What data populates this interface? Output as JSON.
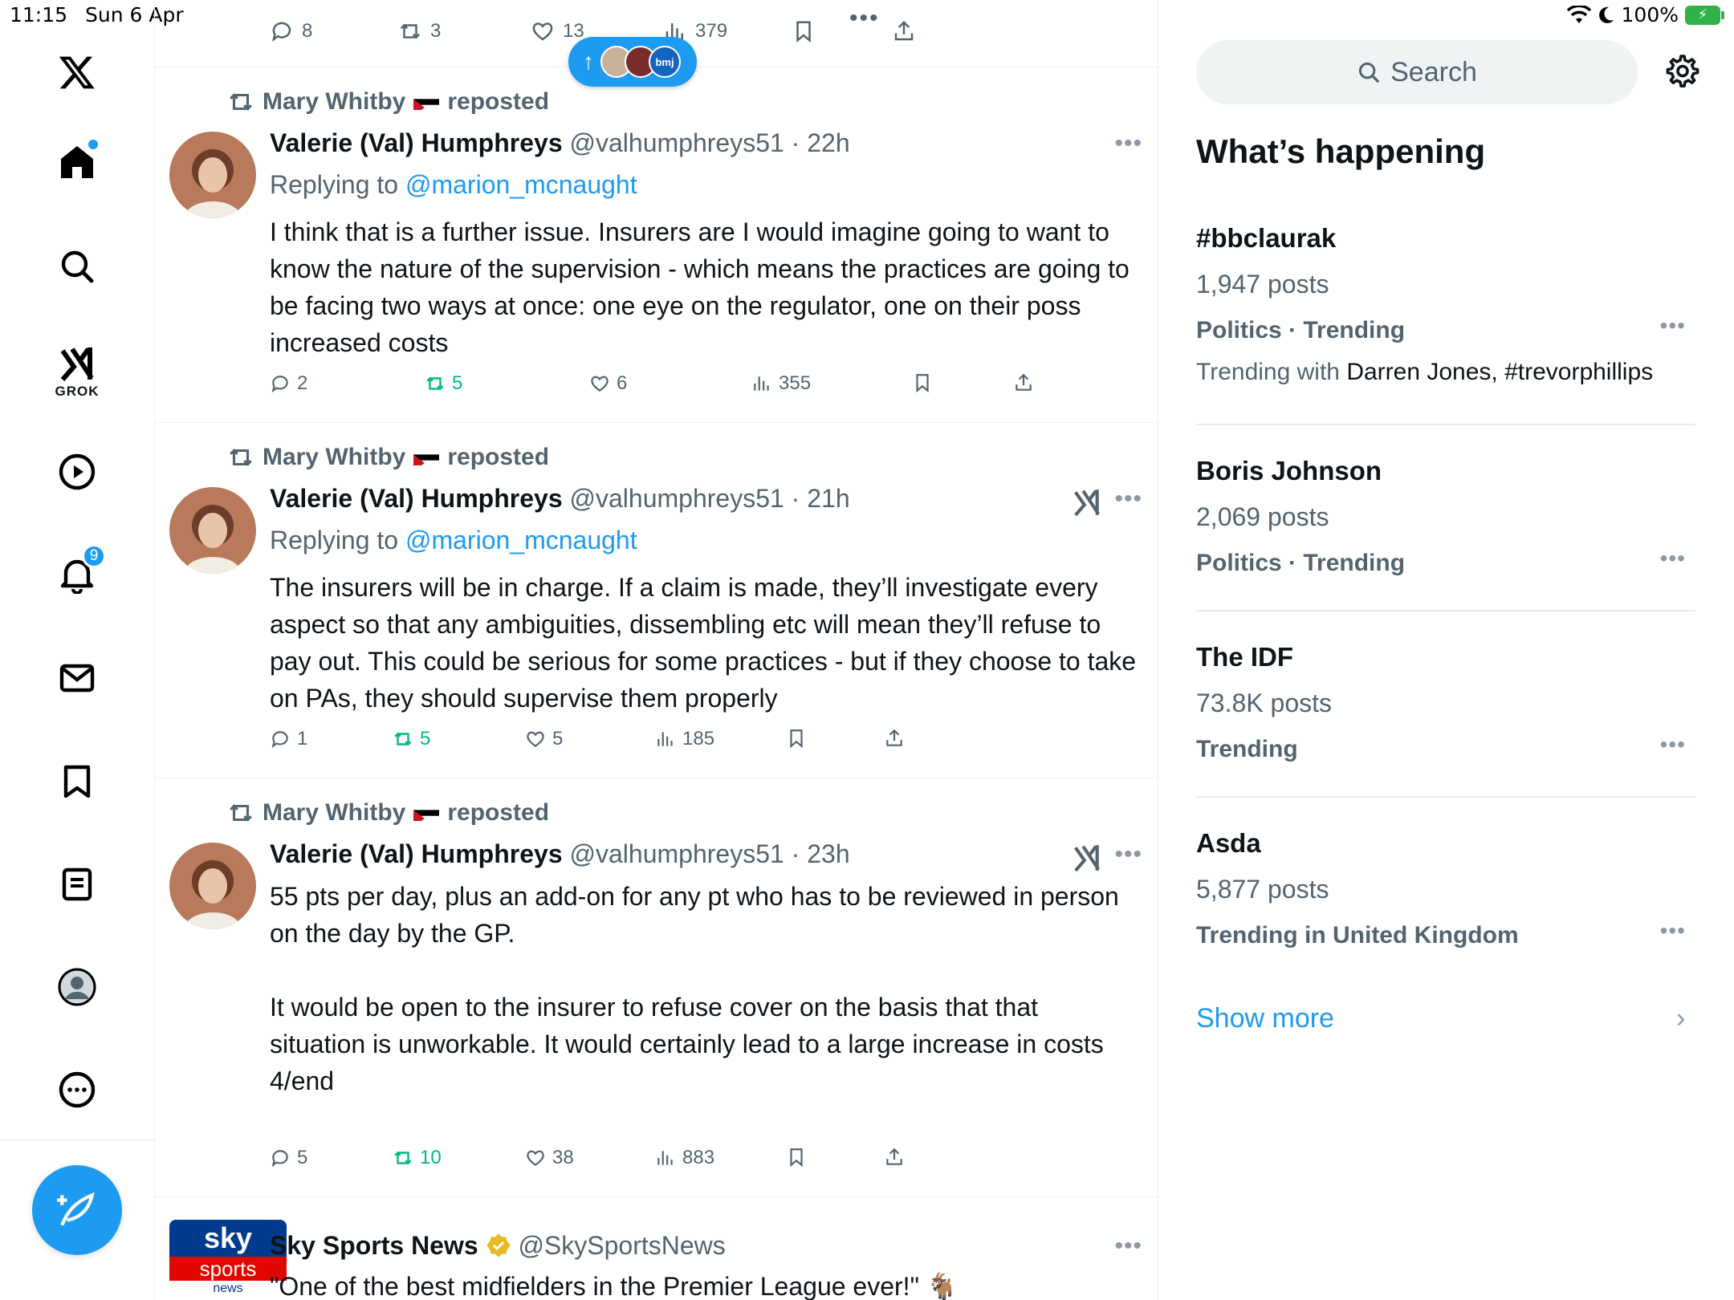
{
  "status_bar": {
    "time": "11:15",
    "date": "Sun 6 Apr",
    "battery": "100%"
  },
  "nav": {
    "grok_label": "GROK",
    "notifications_count": "9"
  },
  "top_actions": {
    "replies": "8",
    "reposts": "3",
    "likes": "13",
    "views": "379"
  },
  "pill": {
    "label": "bmj"
  },
  "tweets": [
    {
      "reposted_by": "Mary Whitby",
      "reposted_label": "reposted",
      "name": "Valerie (Val) Humphreys",
      "handle": "@valhumphreys51 · 22h",
      "replying_prefix": "Replying to ",
      "replying_to": "@marion_mcnaught",
      "text": "I think that is a further issue. Insurers are I would imagine going to want to know the nature of the supervision - which means the practices are going to be facing two ways at once: one eye on the regulator, one on their poss increased costs",
      "replies": "2",
      "reposts": "5",
      "likes": "6",
      "views": "355"
    },
    {
      "reposted_by": "Mary Whitby",
      "reposted_label": "reposted",
      "name": "Valerie (Val) Humphreys",
      "handle": "@valhumphreys51 · 21h",
      "replying_prefix": "Replying to ",
      "replying_to": "@marion_mcnaught",
      "text": "The insurers will be in charge. If a claim is made, they’ll investigate every aspect so that any ambiguities, dissembling etc will mean they’ll refuse to pay out. This could be serious for some practices - but if they choose to take on PAs, they should supervise them properly",
      "replies": "1",
      "reposts": "5",
      "likes": "5",
      "views": "185"
    },
    {
      "reposted_by": "Mary Whitby",
      "reposted_label": "reposted",
      "name": "Valerie (Val) Humphreys",
      "handle": "@valhumphreys51 · 23h",
      "text": "55 pts per day, plus an add-on for any pt who has to be reviewed in person on the day by the GP.\n\nIt would be open to the insurer to refuse cover on the basis that that situation is unworkable. It would certainly lead to a large increase in costs\n4/end",
      "replies": "5",
      "reposts": "10",
      "likes": "38",
      "views": "883"
    },
    {
      "name": "Sky Sports News",
      "handle": "@SkySportsNews",
      "text": "\"One of the best midfielders in the Premier League ever!\" 🐐",
      "avatar_text_1": "sky",
      "avatar_text_2": "sports",
      "avatar_text_3": "news"
    }
  ],
  "sidebar": {
    "search_placeholder": "Search",
    "title": "What’s happening",
    "trends": [
      {
        "name": "#bbclaurak",
        "posts": "1,947 posts",
        "category": "Politics · Trending",
        "with_prefix": "Trending with ",
        "with": "Darren Jones, #trevorphillips"
      },
      {
        "name": "Boris Johnson",
        "posts": "2,069 posts",
        "category": "Politics · Trending"
      },
      {
        "name": "The IDF",
        "posts": "73.8K posts",
        "category": "Trending"
      },
      {
        "name": "Asda",
        "posts": "5,877 posts",
        "category": "Trending in United Kingdom"
      }
    ],
    "show_more": "Show more"
  },
  "colors": {
    "accent": "#1d9bf0",
    "repost": "#00ba7c",
    "muted": "#536471"
  }
}
